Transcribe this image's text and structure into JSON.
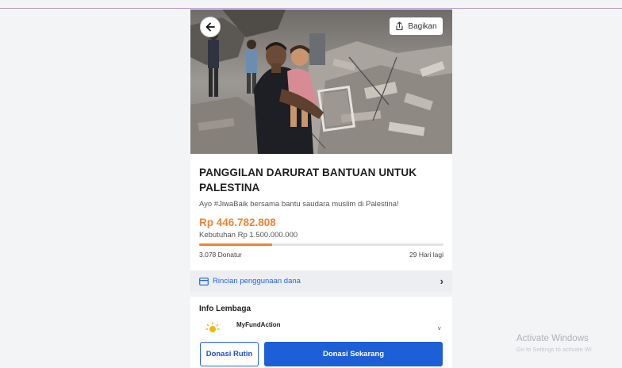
{
  "campaign": {
    "share_label": "Bagikan",
    "title_line1": "PANGGILAN DARURAT BANTUAN UNTUK",
    "title_line2": "PALESTINA",
    "subtitle": "Ayo #JiwaBaik bersama bantu saudara muslim di Palestina!",
    "amount": "Rp 446.782.808",
    "target": "Kebutuhan Rp 1.500.000.000",
    "progress_fraction": 0.298,
    "donors": "3.078 Donatur",
    "days_left": "29 Hari lagi"
  },
  "breakdown": {
    "label": "Rincian penggunaan dana"
  },
  "organization": {
    "heading": "Info Lembaga",
    "name": "MyFundAction"
  },
  "actions": {
    "routine_label": "Donasi Rutin",
    "donate_now_label": "Donasi Sekarang"
  },
  "system": {
    "activate_title": "Activate Windows",
    "activate_sub": "Go to Settings to activate Wi"
  },
  "colors": {
    "accent_orange": "#ef8433",
    "primary_blue": "#1d5fd6"
  },
  "icons": [
    "back-arrow-icon",
    "share-icon",
    "card-icon",
    "chevron-right-icon",
    "org-logo-icon"
  ]
}
